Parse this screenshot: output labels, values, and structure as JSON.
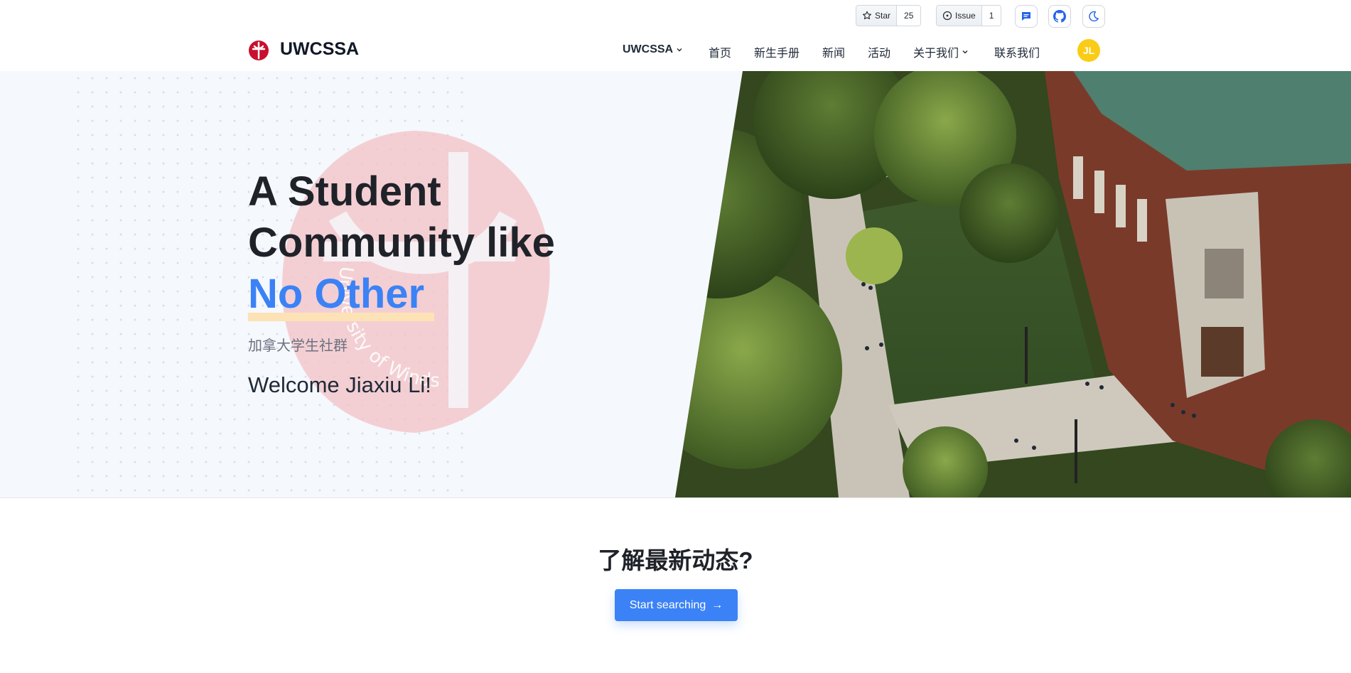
{
  "topbar": {
    "star": {
      "label": "Star",
      "count": "25"
    },
    "issue": {
      "label": "Issue",
      "count": "1"
    },
    "icons": [
      "chat-icon",
      "github-icon",
      "moon-icon"
    ]
  },
  "nav": {
    "brand": "UWCSSA",
    "items": [
      {
        "label": "UWCSSA",
        "dropdown": true
      },
      {
        "label": "首页"
      },
      {
        "label": "新生手册"
      },
      {
        "label": "新闻"
      },
      {
        "label": "活动"
      },
      {
        "label": "关于我们",
        "dropdown": true
      },
      {
        "label": "联系我们"
      }
    ],
    "avatar_initials": "JL"
  },
  "hero": {
    "title_line1": "A Student",
    "title_line2": "Community like",
    "title_highlight": "No Other",
    "subtitle": "加拿大学生社群",
    "welcome": "Welcome Jiaxiu Li!",
    "watermark_text": "University of Windsor"
  },
  "cta": {
    "title": "了解最新动态?",
    "button_label": "Start searching",
    "button_arrow": "→"
  },
  "colors": {
    "accent": "#3b82f6",
    "avatar": "#facc15",
    "brand_red": "#c8102e"
  }
}
